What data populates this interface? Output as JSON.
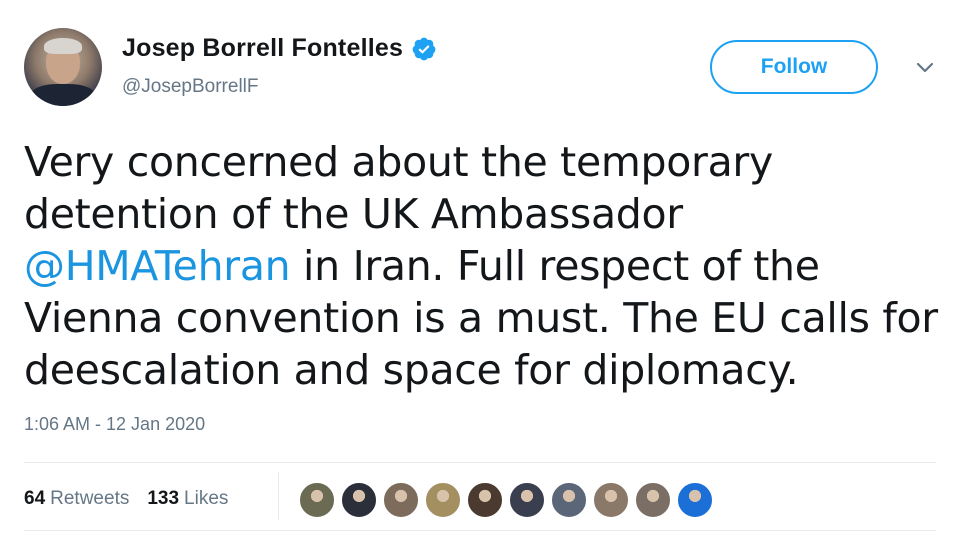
{
  "tweet": {
    "author": {
      "display_name": "Josep Borrell Fontelles",
      "handle": "@JosepBorrellF",
      "verified": true
    },
    "follow_label": "Follow",
    "text_lines": [
      {
        "before": "Very concerned about the temporary",
        "mention": "",
        "after": ""
      },
      {
        "before": "detention of the UK Ambassador",
        "mention": "",
        "after": ""
      },
      {
        "before": "",
        "mention": "@HMATehran",
        "after": " in Iran. Full respect of the"
      },
      {
        "before": "Vienna convention is a must. The EU calls for",
        "mention": "",
        "after": ""
      },
      {
        "before": "deescalation and space for diplomacy.",
        "mention": "",
        "after": ""
      }
    ],
    "timestamp": "1:06 AM - 12 Jan 2020",
    "stats": {
      "retweets_count": "64",
      "retweets_label": "Retweets",
      "likes_count": "133",
      "likes_label": "Likes"
    },
    "liker_avatars": [
      {
        "icon": "user-avatar",
        "color": "#6b6a52"
      },
      {
        "icon": "user-avatar",
        "color": "#2b2f3a"
      },
      {
        "icon": "user-avatar",
        "color": "#7d6b5c"
      },
      {
        "icon": "user-avatar",
        "color": "#a38f60"
      },
      {
        "icon": "user-avatar",
        "color": "#4a3a30"
      },
      {
        "icon": "user-avatar",
        "color": "#3a3f4f"
      },
      {
        "icon": "user-avatar",
        "color": "#5b6678"
      },
      {
        "icon": "user-avatar",
        "color": "#8a7868"
      },
      {
        "icon": "user-avatar",
        "color": "#7b6f65"
      },
      {
        "icon": "user-avatar",
        "color": "#1c6fd6"
      }
    ],
    "colors": {
      "accent": "#1da1f2",
      "link": "#1b95e0",
      "muted": "#657786",
      "text": "#14171a"
    }
  }
}
